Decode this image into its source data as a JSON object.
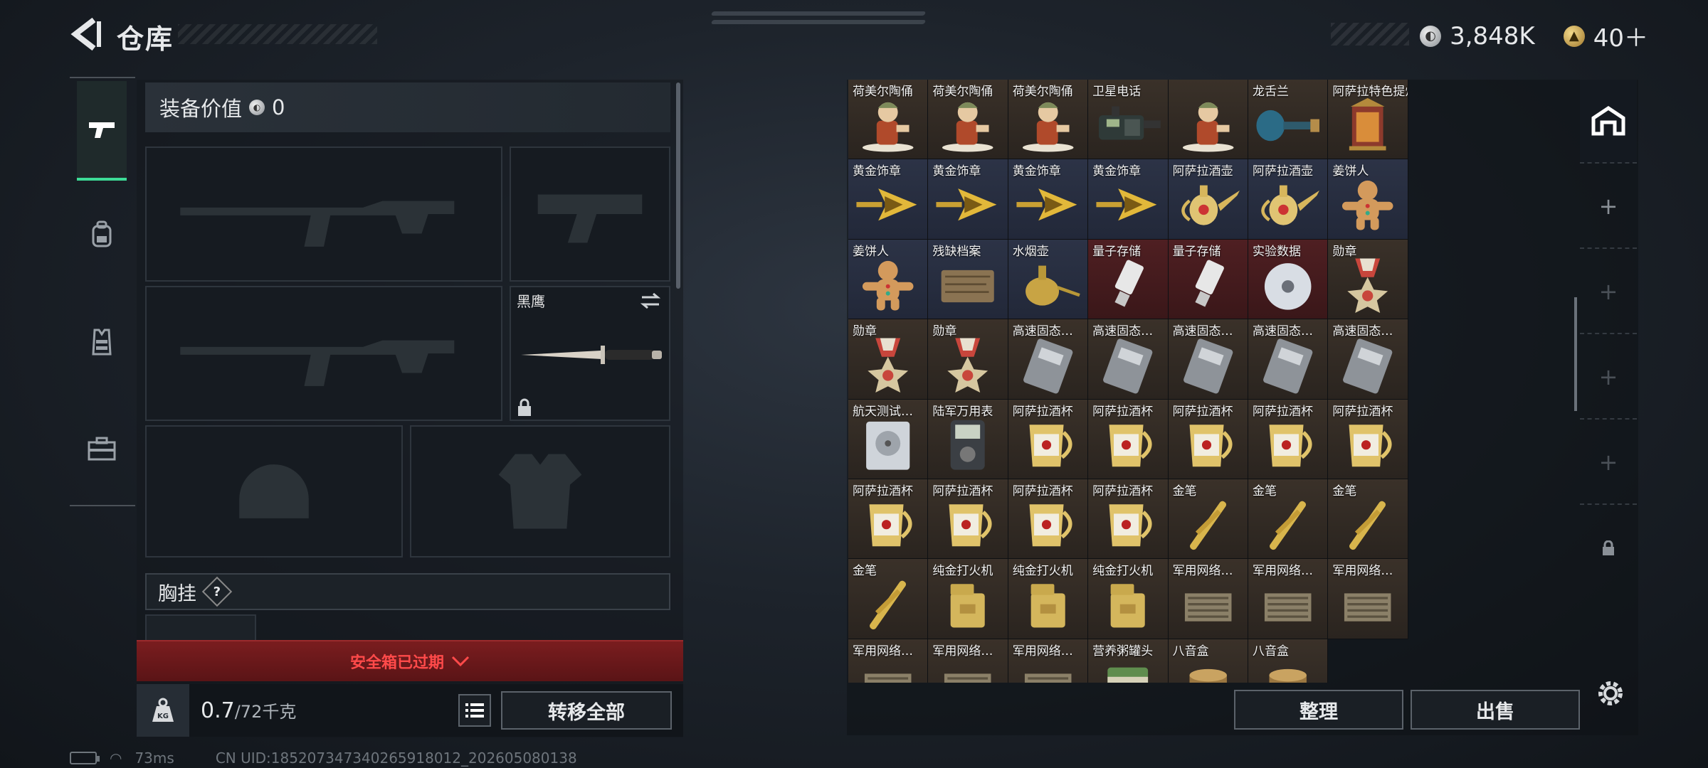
{
  "header": {
    "title": "仓库",
    "silver_amount": "3,848K",
    "gold_amount": "40＋"
  },
  "colors": {
    "accent": "#3ddc97",
    "warning": "#ff4a4a"
  },
  "side_tabs": [
    {
      "icon": "pistol-icon",
      "active": true
    },
    {
      "icon": "backpack-icon",
      "active": false
    },
    {
      "icon": "vest-icon",
      "active": false
    },
    {
      "icon": "case-icon",
      "active": false
    }
  ],
  "equipment": {
    "value_label": "装备价值",
    "value": "0",
    "melee_name": "黑鹰",
    "chest_rig_label": "胸挂",
    "chest_rig_help": "?"
  },
  "safe_box": {
    "status": "安全箱已过期"
  },
  "weight": {
    "current": "0.7",
    "max": "/72千克",
    "icon_text": "KG"
  },
  "buttons": {
    "transfer_all": "转移全部",
    "tidy": "整理",
    "sell": "出售"
  },
  "warehouse": {
    "items": [
      {
        "name": "荷美尔陶俑",
        "icon": "figurine-icon",
        "bg": "brown"
      },
      {
        "name": "荷美尔陶俑",
        "icon": "figurine-icon",
        "bg": "brown"
      },
      {
        "name": "荷美尔陶俑",
        "icon": "figurine-icon",
        "bg": "brown"
      },
      {
        "name": "卫星电话",
        "icon": "satphone-icon",
        "bg": "brown"
      },
      {
        "name": "",
        "icon": "figurine-icon",
        "bg": "brown"
      },
      {
        "name": "龙舌兰",
        "icon": "bottle-icon",
        "bg": "brown"
      },
      {
        "name": "阿萨拉特色提灯",
        "icon": "lantern-icon",
        "bg": "brown"
      },
      {
        "name": "黄金饰章",
        "icon": "gold-badge-icon",
        "bg": "blue"
      },
      {
        "name": "黄金饰章",
        "icon": "gold-badge-icon",
        "bg": "blue"
      },
      {
        "name": "黄金饰章",
        "icon": "gold-badge-icon",
        "bg": "blue"
      },
      {
        "name": "黄金饰章",
        "icon": "gold-badge-icon",
        "bg": "blue"
      },
      {
        "name": "阿萨拉酒壶",
        "icon": "ewer-icon",
        "bg": "blue"
      },
      {
        "name": "阿萨拉酒壶",
        "icon": "ewer-icon",
        "bg": "blue"
      },
      {
        "name": "姜饼人",
        "icon": "gingerbread-icon",
        "bg": "blue"
      },
      {
        "name": "姜饼人",
        "icon": "gingerbread-icon",
        "bg": "blue"
      },
      {
        "name": "残缺档案",
        "icon": "scroll-icon",
        "bg": "blue"
      },
      {
        "name": "水烟壶",
        "icon": "hookah-icon",
        "bg": "blue"
      },
      {
        "name": "量子存储",
        "icon": "usb-icon",
        "bg": "red"
      },
      {
        "name": "量子存储",
        "icon": "usb-icon",
        "bg": "red"
      },
      {
        "name": "实验数据",
        "icon": "disc-icon",
        "bg": "red"
      },
      {
        "name": "勋章",
        "icon": "medal-icon",
        "bg": "brown"
      },
      {
        "name": "勋章",
        "icon": "medal-icon",
        "bg": "brown"
      },
      {
        "name": "勋章",
        "icon": "medal-icon",
        "bg": "brown"
      },
      {
        "name": "高速固态…",
        "icon": "ssd-icon",
        "bg": "brown"
      },
      {
        "name": "高速固态…",
        "icon": "ssd-icon",
        "bg": "brown"
      },
      {
        "name": "高速固态…",
        "icon": "ssd-icon",
        "bg": "brown"
      },
      {
        "name": "高速固态…",
        "icon": "ssd-icon",
        "bg": "brown"
      },
      {
        "name": "高速固态…",
        "icon": "ssd-icon",
        "bg": "brown"
      },
      {
        "name": "航天测试…",
        "icon": "hdd-icon",
        "bg": "brown"
      },
      {
        "name": "陆军万用表",
        "icon": "multimeter-icon",
        "bg": "brown"
      },
      {
        "name": "阿萨拉酒杯",
        "icon": "cup-icon",
        "bg": "brown"
      },
      {
        "name": "阿萨拉酒杯",
        "icon": "cup-icon",
        "bg": "brown"
      },
      {
        "name": "阿萨拉酒杯",
        "icon": "cup-icon",
        "bg": "brown"
      },
      {
        "name": "阿萨拉酒杯",
        "icon": "cup-icon",
        "bg": "brown"
      },
      {
        "name": "阿萨拉酒杯",
        "icon": "cup-icon",
        "bg": "brown"
      },
      {
        "name": "阿萨拉酒杯",
        "icon": "cup-icon",
        "bg": "brown"
      },
      {
        "name": "阿萨拉酒杯",
        "icon": "cup-icon",
        "bg": "brown"
      },
      {
        "name": "阿萨拉酒杯",
        "icon": "cup-icon",
        "bg": "brown"
      },
      {
        "name": "阿萨拉酒杯",
        "icon": "cup-icon",
        "bg": "brown"
      },
      {
        "name": "金笔",
        "icon": "pen-icon",
        "bg": "brown"
      },
      {
        "name": "金笔",
        "icon": "pen-icon",
        "bg": "brown"
      },
      {
        "name": "金笔",
        "icon": "pen-icon",
        "bg": "brown"
      },
      {
        "name": "金笔",
        "icon": "pen-icon",
        "bg": "brown"
      },
      {
        "name": "纯金打火机",
        "icon": "lighter-icon",
        "bg": "brown"
      },
      {
        "name": "纯金打火机",
        "icon": "lighter-icon",
        "bg": "brown"
      },
      {
        "name": "纯金打火机",
        "icon": "lighter-icon",
        "bg": "brown"
      },
      {
        "name": "军用网络…",
        "icon": "router-icon",
        "bg": "brown"
      },
      {
        "name": "军用网络…",
        "icon": "router-icon",
        "bg": "brown"
      },
      {
        "name": "军用网络…",
        "icon": "router-icon",
        "bg": "brown"
      },
      {
        "name": "军用网络…",
        "icon": "router-icon",
        "bg": "brown"
      },
      {
        "name": "军用网络…",
        "icon": "router-icon",
        "bg": "brown"
      },
      {
        "name": "军用网络…",
        "icon": "router-icon",
        "bg": "brown"
      },
      {
        "name": "营养粥罐头",
        "icon": "can-icon",
        "bg": "brown"
      },
      {
        "name": "八音盒",
        "icon": "musicbox-icon",
        "bg": "brown"
      },
      {
        "name": "八音盒",
        "icon": "musicbox-icon",
        "bg": "brown"
      }
    ]
  },
  "status_bar": {
    "ping": "73ms",
    "uid": "CN UID:185207347340265918012_202605080138"
  }
}
